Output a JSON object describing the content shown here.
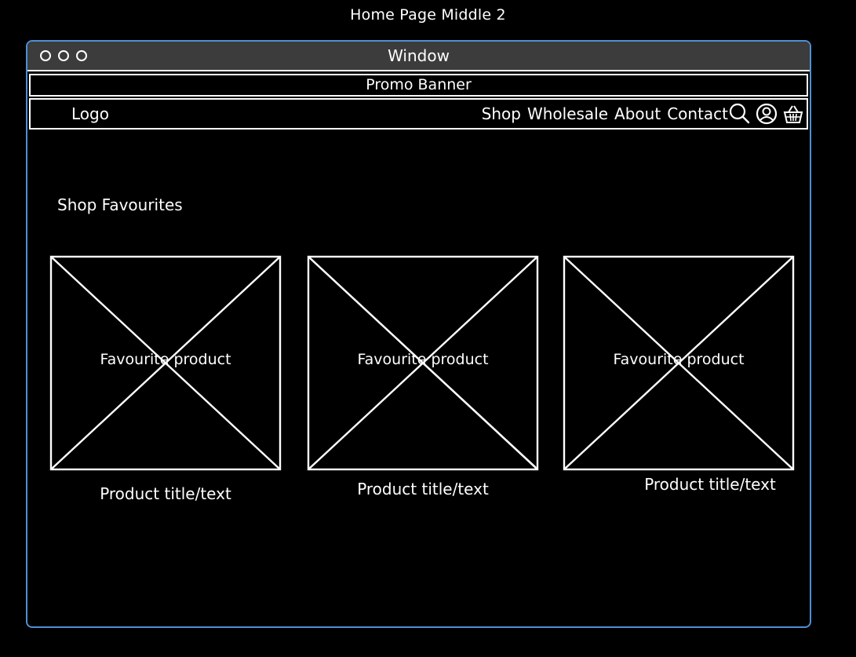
{
  "page_title": "Home Page Middle 2",
  "window": {
    "title": "Window"
  },
  "promo_banner": "Promo Banner",
  "nav": {
    "logo": "Logo",
    "links": [
      "Shop",
      "Wholesale",
      "About",
      "Contact"
    ],
    "icons": [
      "search-icon",
      "user-icon",
      "basket-icon"
    ]
  },
  "section_title": "Shop Favourites",
  "products": [
    {
      "image_label": "Favourite product",
      "title": "Product title/text"
    },
    {
      "image_label": "Favourite product",
      "title": "Product title/text"
    },
    {
      "image_label": "Favourite product",
      "title": "Product title/text"
    }
  ],
  "colors": {
    "background": "#000000",
    "window_border": "#4f8fd6",
    "titlebar": "#3c3c3c",
    "lines": "#ffffff"
  }
}
